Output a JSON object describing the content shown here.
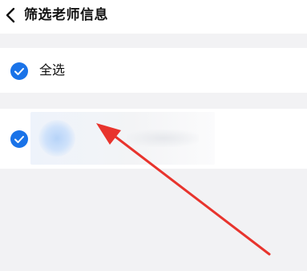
{
  "header": {
    "title": "筛选老师信息",
    "back_icon": "chevron-left-icon"
  },
  "options": {
    "select_all": {
      "label": "全选",
      "checked": true
    },
    "teacher": {
      "checked": true
    }
  },
  "colors": {
    "accent": "#1a73e8",
    "annotation_arrow": "#e8342d",
    "background": "#f2f2f4",
    "row_background": "#ffffff"
  }
}
